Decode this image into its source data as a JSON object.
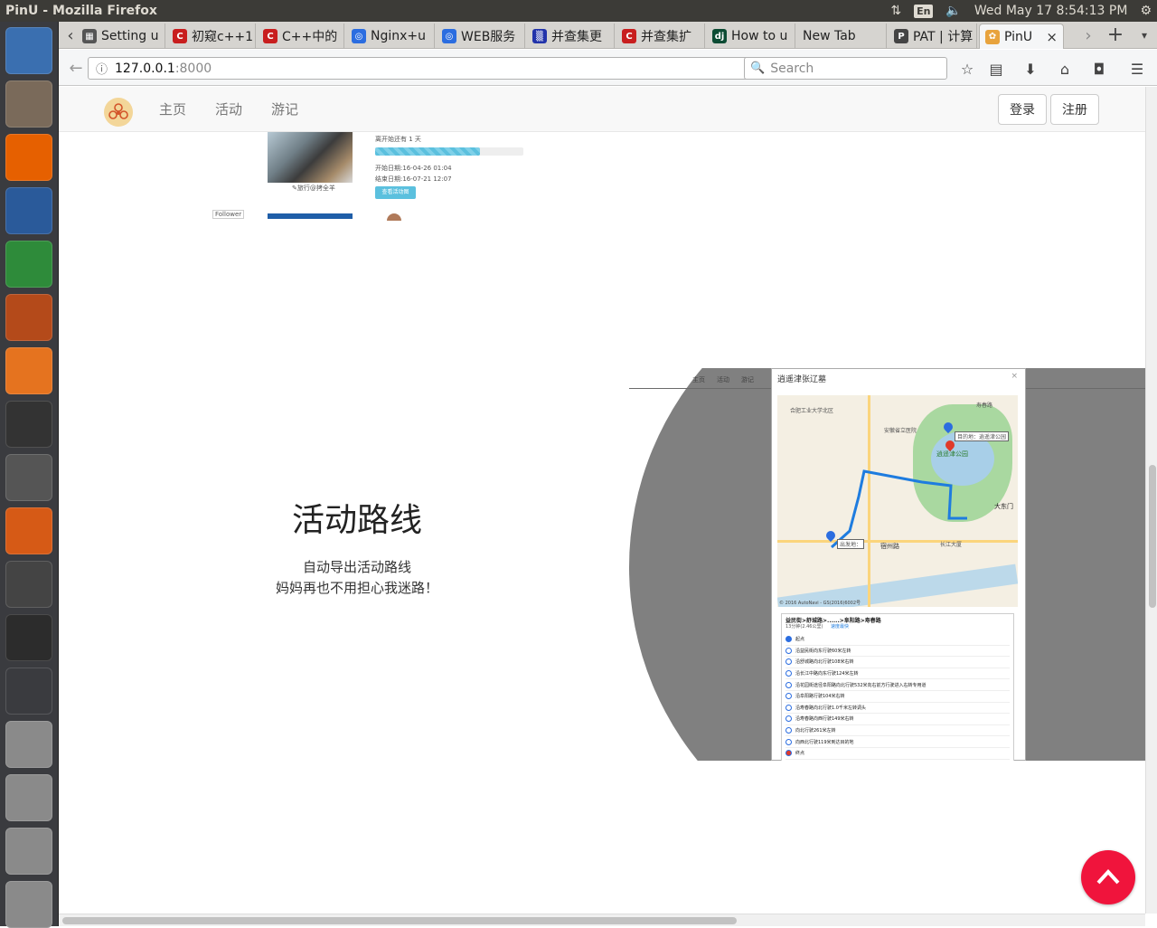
{
  "window": {
    "title": "PinU - Mozilla Firefox"
  },
  "top_panel": {
    "keyboard_layout": "En",
    "clock": "Wed May 17  8:54:13 PM"
  },
  "launcher": {
    "items": [
      {
        "name": "ubuntu-dash-icon",
        "color": "#3a6fb0"
      },
      {
        "name": "files-icon",
        "color": "#7a6a5a"
      },
      {
        "name": "firefox-icon",
        "color": "#e66000"
      },
      {
        "name": "libreoffice-writer-icon",
        "color": "#2a5a9a"
      },
      {
        "name": "libreoffice-calc-icon",
        "color": "#2e8b3a"
      },
      {
        "name": "libreoffice-impress-icon",
        "color": "#b44a1a"
      },
      {
        "name": "software-center-icon",
        "color": "#e5731f"
      },
      {
        "name": "amazon-icon",
        "color": "#333333"
      },
      {
        "name": "system-settings-icon",
        "color": "#555555"
      },
      {
        "name": "cd-icon",
        "color": "#d65a16"
      },
      {
        "name": "colored-squares-icon",
        "color": "#444444"
      },
      {
        "name": "terminal-icon",
        "color": "#2c2c2c"
      },
      {
        "name": "workspace-switcher-icon",
        "color": "#3a3b3f"
      },
      {
        "name": "drive-1-icon",
        "color": "#8a8a8a"
      },
      {
        "name": "drive-2-icon",
        "color": "#8a8a8a"
      },
      {
        "name": "drive-3-icon",
        "color": "#8a8a8a"
      },
      {
        "name": "drive-4-icon",
        "color": "#8a8a8a"
      }
    ]
  },
  "browser": {
    "tabs": [
      {
        "label": "Setting u",
        "icon_color": "#555555",
        "icon_text": "▦"
      },
      {
        "label": "初窥c++1",
        "icon_color": "#c81e1e",
        "icon_text": "C"
      },
      {
        "label": "C++中的",
        "icon_color": "#c81e1e",
        "icon_text": "C"
      },
      {
        "label": "Nginx+u",
        "icon_color": "#2b6de0",
        "icon_text": "◎"
      },
      {
        "label": "WEB服务",
        "icon_color": "#2b6de0",
        "icon_text": "◎"
      },
      {
        "label": "并查集更",
        "icon_color": "#2233aa",
        "icon_text": "▒"
      },
      {
        "label": "并查集扩",
        "icon_color": "#c81e1e",
        "icon_text": "C"
      },
      {
        "label": "How to u",
        "icon_color": "#0c4b33",
        "icon_text": "dj"
      },
      {
        "label": "New Tab",
        "icon_color": "",
        "icon_text": ""
      },
      {
        "label": "PAT | 计算",
        "icon_color": "#444444",
        "icon_text": "P"
      },
      {
        "label": "PinU",
        "icon_color": "#e8a33d",
        "icon_text": "✿"
      }
    ],
    "url_host": "127.0.0.1",
    "url_port": ":8000",
    "search_placeholder": "Search"
  },
  "site": {
    "nav": [
      "主页",
      "活动",
      "游记"
    ],
    "login": "登录",
    "register": "注册",
    "card": {
      "countdown": "离开始还有 1 天",
      "start": "开始日期:16-04-26 01:04",
      "end": "结束日期:16-07-21 12:07",
      "button": "查看活动图",
      "caption": "✎旅行@拷全羊",
      "follower": "Follower"
    },
    "feature": {
      "title": "活动路线",
      "line1": "自动导出活动路线",
      "line2": "妈妈再也不用担心我迷路！"
    },
    "map_preview": {
      "nav": [
        "主页",
        "活动",
        "游记"
      ],
      "title": "逍遥津张辽墓",
      "destination": "目的地：逍遥津公园",
      "origin": "出发地：",
      "park": "逍遥津公园",
      "roads": [
        "寿春路",
        "长江大厦",
        "大东门",
        "合肥工业大学北区",
        "安徽省立医院",
        "宿州路"
      ],
      "copyright": "© 2016 AutoNavi - GS(2016)6002号",
      "route_title": "益民街>舒城路>......>阜阳路>寿春路",
      "route_meta": "13分钟(2.46公里)",
      "route_fastest": "速度最快",
      "steps": [
        "起点",
        "沿益民街向东行驶60米左转",
        "沿舒城路向北行驶108米右转",
        "沿长江中路向东行驶124米左转",
        "沿花园街途径阜阳路向北行驶532米向右前方行驶进入右转专用道",
        "沿阜阳路行驶104米右转",
        "沿寿春路向北行驶1.0千米左转调头",
        "沿寿春路向西行驶149米右转",
        "向北行驶261米左转",
        "向西北行驶119米到达目的地",
        "终点"
      ]
    }
  }
}
